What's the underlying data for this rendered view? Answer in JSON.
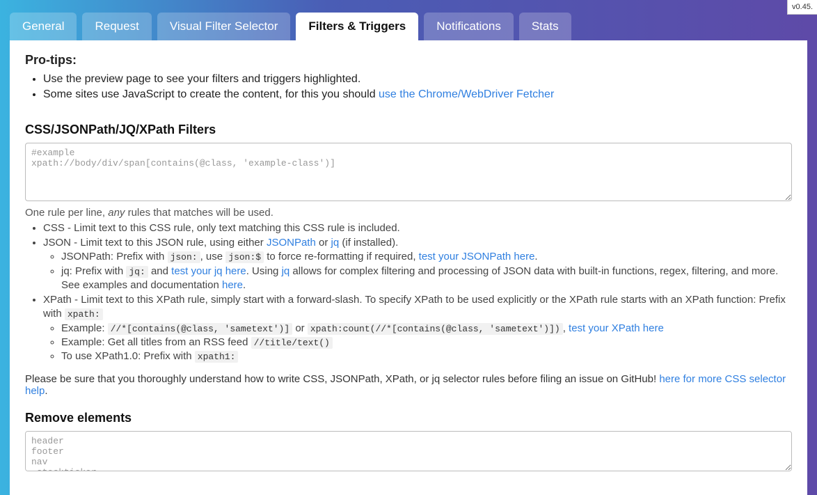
{
  "version": "v0.45.",
  "tabs": [
    {
      "label": "General",
      "active": false
    },
    {
      "label": "Request",
      "active": false
    },
    {
      "label": "Visual Filter Selector",
      "active": false
    },
    {
      "label": "Filters & Triggers",
      "active": true
    },
    {
      "label": "Notifications",
      "active": false
    },
    {
      "label": "Stats",
      "active": false
    }
  ],
  "protips": {
    "title": "Pro-tips:",
    "items": [
      "Use the preview page to see your filters and triggers highlighted.",
      "Some sites use JavaScript to create the content, for this you should "
    ],
    "link_chrome": "use the Chrome/WebDriver Fetcher"
  },
  "filters": {
    "title": "CSS/JSONPath/JQ/XPath Filters",
    "placeholder": "#example\nxpath://body/div/span[contains(@class, 'example-class')]",
    "value": "",
    "hint_prefix": "One rule per line, ",
    "hint_em": "any",
    "hint_suffix": " rules that matches will be used."
  },
  "rules": {
    "css": "CSS - Limit text to this CSS rule, only text matching this CSS rule is included.",
    "json_prefix": "JSON - Limit text to this JSON rule, using either ",
    "json_link1": "JSONPath",
    "json_or": " or ",
    "json_link2": "jq",
    "json_suffix": " (if installed).",
    "jsonpath_sub_prefix": "JSONPath: Prefix with ",
    "jsonpath_code1": "json:",
    "jsonpath_sub_mid": ", use ",
    "jsonpath_code2": "json:$",
    "jsonpath_sub_mid2": " to force re-formatting if required, ",
    "jsonpath_link": "test your JSONPath here",
    "jsonpath_sub_end": ".",
    "jq_prefix": "jq: Prefix with ",
    "jq_code": "jq:",
    "jq_and": " and ",
    "jq_link1": "test your jq here",
    "jq_mid": ". Using ",
    "jq_link2": "jq",
    "jq_suffix": " allows for complex filtering and processing of JSON data with built-in functions, regex, filtering, and more. See examples and documentation ",
    "jq_link3": "here",
    "jq_end": ".",
    "xpath_prefix": "XPath - Limit text to this XPath rule, simply start with a forward-slash. To specify XPath to be used explicitly or the XPath rule starts with an XPath function: Prefix with ",
    "xpath_code": "xpath:",
    "xpath_ex_prefix": "Example: ",
    "xpath_ex_code1": "//*[contains(@class, 'sametext')]",
    "xpath_ex_or": " or ",
    "xpath_ex_code2": "xpath:count(//*[contains(@class, 'sametext')])",
    "xpath_ex_comma": ", ",
    "xpath_ex_link": "test your XPath here",
    "xpath_rss_prefix": "Example: Get all titles from an RSS feed ",
    "xpath_rss_code": "//title/text()",
    "xpath1_prefix": "To use XPath1.0: Prefix with ",
    "xpath1_code": "xpath1:"
  },
  "footer": {
    "text": "Please be sure that you thoroughly understand how to write CSS, JSONPath, XPath, or jq selector rules before filing an issue on GitHub! ",
    "link": "here for more CSS selector help",
    "end": "."
  },
  "remove": {
    "title": "Remove elements",
    "placeholder": "header\nfooter\nnav\n.stockticker",
    "value": ""
  }
}
